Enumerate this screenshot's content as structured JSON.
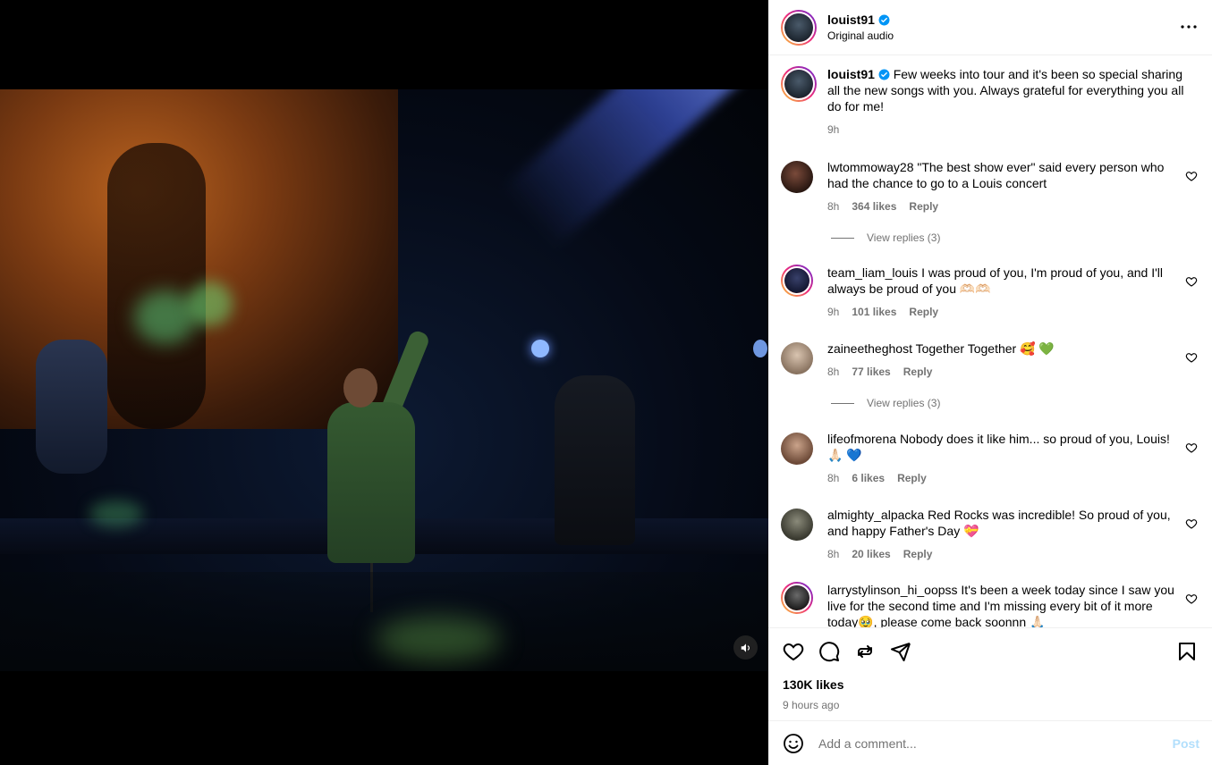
{
  "post": {
    "author": "louist91",
    "audio": "Original audio",
    "caption": "Few weeks into tour and it's been so special sharing all the new songs with you. Always grateful for everything you all do for me!",
    "caption_time": "9h"
  },
  "comments": [
    {
      "user": "lwtommoway28",
      "text": "\"The best show ever\" said every person who had the chance to go to a Louis concert",
      "time": "8h",
      "likes": "364 likes",
      "reply": "Reply",
      "view_replies": "View replies (3)"
    },
    {
      "user": "team_liam_louis",
      "text": "I was proud of you, I'm proud of you, and I'll always be proud of you 🫶🏻🫶🏻",
      "time": "9h",
      "likes": "101 likes",
      "reply": "Reply"
    },
    {
      "user": "zaineetheghost",
      "text": "Together Together 🥰 💚",
      "time": "8h",
      "likes": "77 likes",
      "reply": "Reply",
      "view_replies": "View replies (3)"
    },
    {
      "user": "lifeofmorena",
      "text": "Nobody does it like him... so proud of you, Louis! 🙏🏻 💙",
      "time": "8h",
      "likes": "6 likes",
      "reply": "Reply"
    },
    {
      "user": "almighty_alpacka",
      "text": "Red Rocks was incredible! So proud of you, and happy Father's Day 💝",
      "time": "8h",
      "likes": "20 likes",
      "reply": "Reply"
    },
    {
      "user": "larrystylinson_hi_oopss",
      "text": "It's been a week today since I saw you live for the second time and I'm missing every bit of it more today🥹, please come back soonnn 🙏🏻",
      "time": "",
      "likes": "",
      "reply": ""
    }
  ],
  "stats": {
    "likes": "130K likes",
    "ago": "9 hours ago"
  },
  "composer": {
    "placeholder": "Add a comment...",
    "post_label": "Post"
  },
  "colors": {
    "muted": "#737373",
    "post_disabled": "#b2dffc",
    "verified": "#0095f6"
  }
}
